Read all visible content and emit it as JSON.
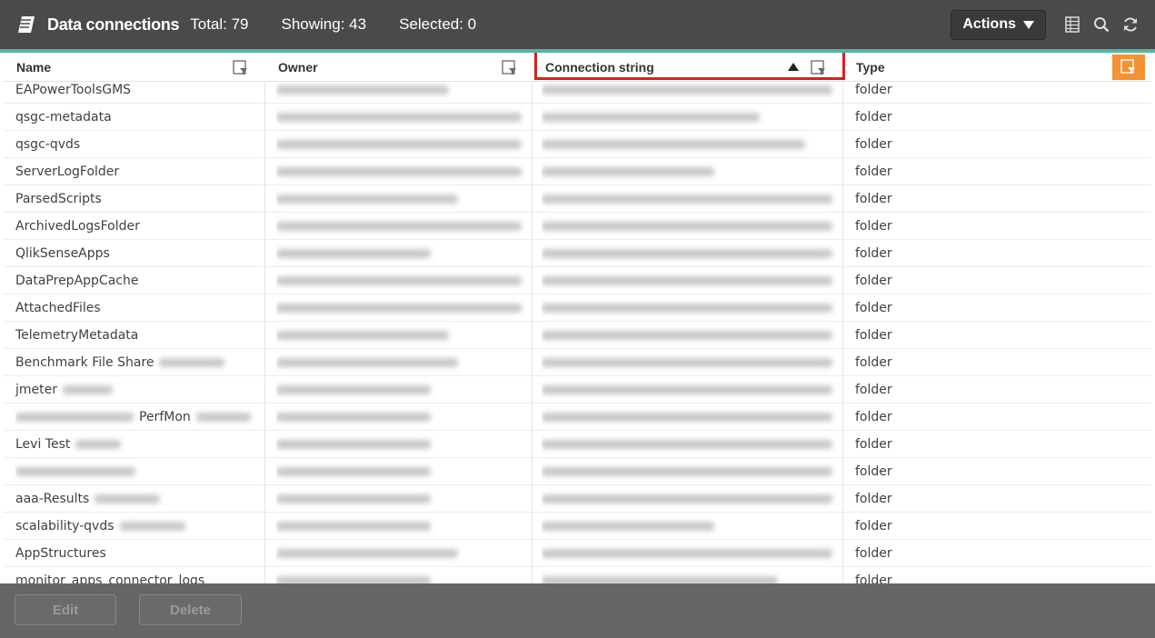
{
  "header": {
    "title": "Data connections",
    "total": "Total: 79",
    "showing": "Showing: 43",
    "selected": "Selected: 0",
    "actions_label": "Actions"
  },
  "icons": {
    "logo": "data-connections-logo-icon",
    "table": "table-icon",
    "search": "search-icon",
    "refresh": "refresh-icon",
    "filter": "filter-icon"
  },
  "table": {
    "columns": [
      {
        "label": "Name"
      },
      {
        "label": "Owner"
      },
      {
        "label": "Connection string"
      },
      {
        "label": "Type"
      }
    ],
    "rows": [
      {
        "name": "EAPowerToolsGMS",
        "type": "folder"
      },
      {
        "name": "qsgc-metadata",
        "type": "folder"
      },
      {
        "name": "qsgc-qvds",
        "type": "folder"
      },
      {
        "name": "ServerLogFolder",
        "type": "folder"
      },
      {
        "name": "ParsedScripts",
        "type": "folder"
      },
      {
        "name": "ArchivedLogsFolder",
        "type": "folder"
      },
      {
        "name": "QlikSenseApps",
        "type": "folder"
      },
      {
        "name": "DataPrepAppCache",
        "type": "folder"
      },
      {
        "name": "AttachedFiles",
        "type": "folder"
      },
      {
        "name": "TelemetryMetadata",
        "type": "folder"
      },
      {
        "name": "Benchmark File Share",
        "type": "folder"
      },
      {
        "name": "jmeter",
        "type": "folder"
      },
      {
        "name": "PerfMon",
        "type": "folder"
      },
      {
        "name": "Levi Test",
        "type": "folder"
      },
      {
        "name": "",
        "type": "folder"
      },
      {
        "name": "aaa-Results",
        "type": "folder"
      },
      {
        "name": "scalability-qvds",
        "type": "folder"
      },
      {
        "name": "AppStructures",
        "type": "folder"
      },
      {
        "name": "monitor_apps_connector_logs",
        "type": "folder"
      }
    ]
  },
  "footer": {
    "edit_label": "Edit",
    "delete_label": "Delete"
  },
  "colors": {
    "topbar": "#4a4a4a",
    "accent": "#52b5a0",
    "highlight": "#d9201f",
    "orange": "#f59234",
    "footer": "#666666"
  }
}
